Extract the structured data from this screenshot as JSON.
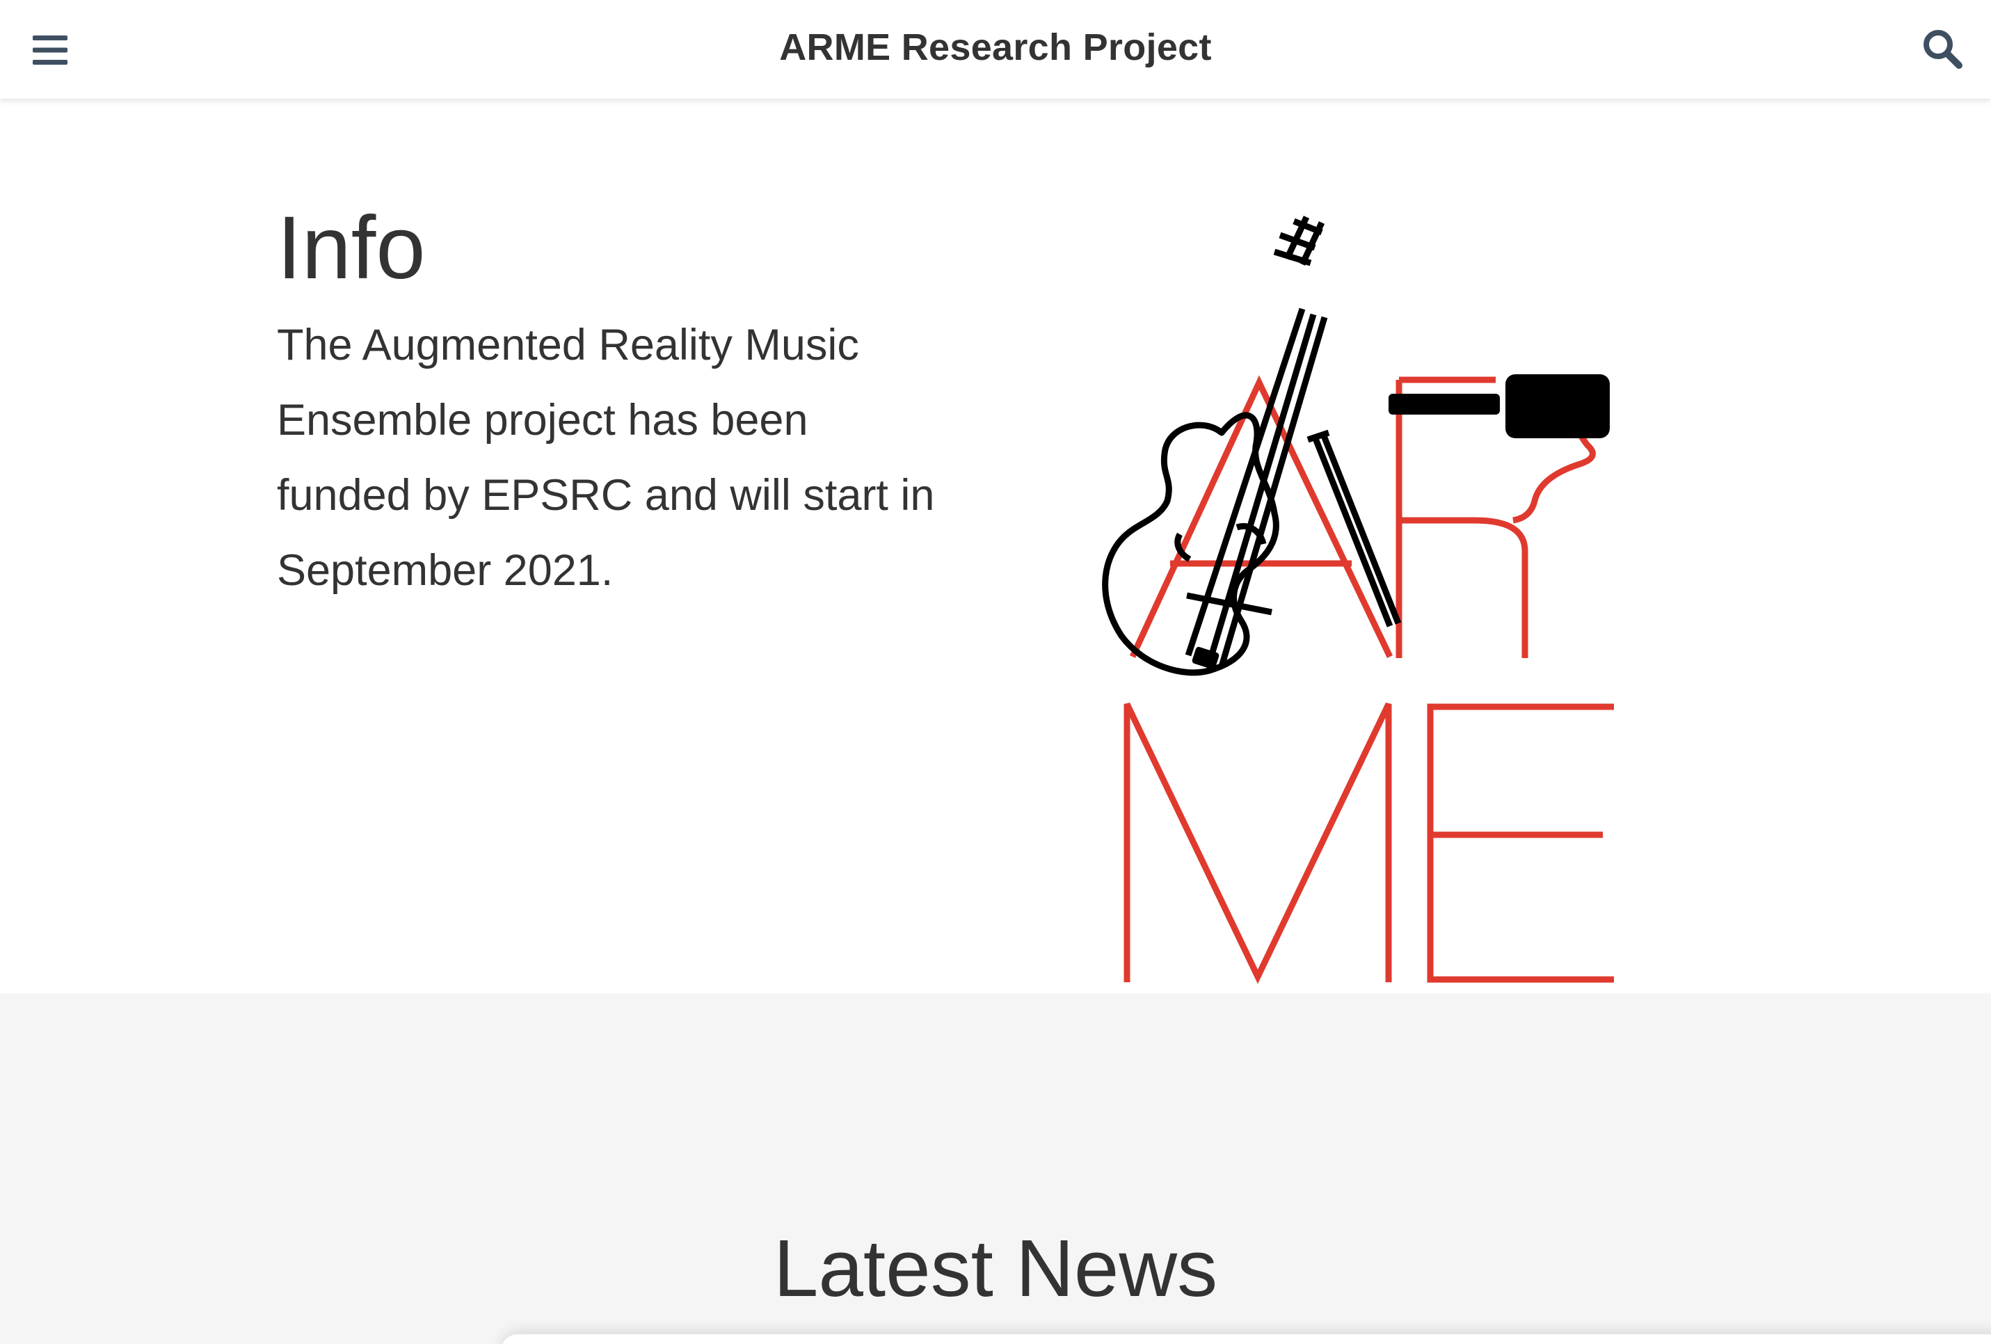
{
  "header": {
    "title": "ARME Research Project",
    "menu_icon": "hamburger-menu-icon",
    "search_icon": "search-icon"
  },
  "info": {
    "heading": "Info",
    "body": "The Augmented Reality Music Ensemble project has been funded by EPSRC and will start in September 2021."
  },
  "logo": {
    "letters": "ARME"
  },
  "news": {
    "heading": "Latest News"
  },
  "colors": {
    "text": "#333333",
    "icon": "#3f4f62",
    "logo_red": "#e03a2f",
    "logo_black": "#000000",
    "news_background": "#f5f5f5"
  }
}
